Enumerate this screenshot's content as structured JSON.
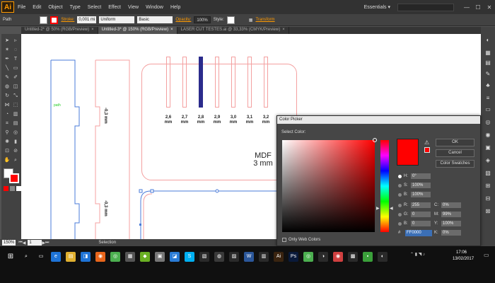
{
  "app": {
    "logo": "Ai",
    "workspace": "Essentials",
    "workspace_arrow": "▾"
  },
  "menu": [
    "File",
    "Edit",
    "Object",
    "Type",
    "Select",
    "Effect",
    "View",
    "Window",
    "Help"
  ],
  "window_controls": [
    "—",
    "☐",
    "✕"
  ],
  "control_bar": {
    "selection_type": "Path",
    "stroke_label": "Stroke:",
    "stroke_weight": "0,001 mi",
    "profile": "Uniform",
    "brush": "Basic",
    "opacity_label": "Opacity:",
    "opacity_value": "100%",
    "style_label": "Style:",
    "transform_label": "Transform",
    "colors": {
      "fill": "#ffffff",
      "stroke": "#ff0000"
    }
  },
  "tabs": [
    {
      "label": "Untitled-2* @ 50% (RGB/Preview)",
      "active": false
    },
    {
      "label": "Untitled-3* @ 150% (RGB/Preview)",
      "active": true
    },
    {
      "label": "LASER CUT TESTES.ai @ 33,33% (CMYK/Preview)",
      "active": false
    }
  ],
  "tab_close": "×",
  "canvas": {
    "measurements": [
      {
        "value": "2,6",
        "unit": "mm"
      },
      {
        "value": "2,7",
        "unit": "mm"
      },
      {
        "value": "2,8",
        "unit": "mm"
      },
      {
        "value": "2,9",
        "unit": "mm"
      },
      {
        "value": "3,0",
        "unit": "mm"
      },
      {
        "value": "3,1",
        "unit": "mm"
      },
      {
        "value": "3,2",
        "unit": "mm"
      }
    ],
    "material": "MDF",
    "thickness": "3 mm",
    "vertical_label_1": "-0,3 mm",
    "vertical_label_2": "-0,3 mm",
    "path_label": "path",
    "colors": {
      "selected_slot": "#2b2b8c",
      "cut_line": "#f4a0a0",
      "selection": "#4a7bd8"
    }
  },
  "status_bar": {
    "zoom": "150%",
    "page": "1",
    "tool": "Selection"
  },
  "color_picker": {
    "title": "Color Picker",
    "select_color_label": "Select Color:",
    "ok": "OK",
    "cancel": "Cancel",
    "swatches": "Color Swatches",
    "warning_icon": "⚠",
    "hsb": [
      {
        "label": "H:",
        "value": "0°",
        "selected": true
      },
      {
        "label": "S:",
        "value": "100%",
        "selected": false
      },
      {
        "label": "B:",
        "value": "100%",
        "selected": false
      }
    ],
    "rgb": [
      {
        "label": "R:",
        "value": "255"
      },
      {
        "label": "G:",
        "value": "0"
      },
      {
        "label": "B:",
        "value": "0"
      }
    ],
    "cmyk": [
      {
        "label": "C:",
        "value": "0%"
      },
      {
        "label": "M:",
        "value": "99%"
      },
      {
        "label": "Y:",
        "value": "100%"
      },
      {
        "label": "K:",
        "value": "0%"
      }
    ],
    "hex_label": "#",
    "hex": "FF0000",
    "only_web_colors": "Only Web Colors",
    "current_color": "#ff0000"
  },
  "taskbar": {
    "time": "17:06",
    "date": "13/02/2017",
    "apps": [
      {
        "name": "search-icon",
        "color": "#101010",
        "glyph": "⌕"
      },
      {
        "name": "task-view-icon",
        "color": "#101010",
        "glyph": "▭"
      },
      {
        "name": "edge-icon",
        "color": "#1e73d6",
        "glyph": "e"
      },
      {
        "name": "explorer-icon",
        "color": "#e0b030",
        "glyph": "▤"
      },
      {
        "name": "store-icon",
        "color": "#1e73d6",
        "glyph": "◨"
      },
      {
        "name": "firefox-icon",
        "color": "#e8661c",
        "glyph": "◉"
      },
      {
        "name": "chrome-icon",
        "color": "#4caf50",
        "glyph": "◎"
      },
      {
        "name": "calculator-icon",
        "color": "#555555",
        "glyph": "▦"
      },
      {
        "name": "greenapp-icon",
        "color": "#6ab023",
        "glyph": "◆"
      },
      {
        "name": "app-icon-1",
        "color": "#777777",
        "glyph": "▣"
      },
      {
        "name": "app-icon-2",
        "color": "#2a7bd5",
        "glyph": "◪"
      },
      {
        "name": "skype-icon",
        "color": "#00aff0",
        "glyph": "S"
      },
      {
        "name": "app-icon-3",
        "color": "#2a2a2a",
        "glyph": "▧"
      },
      {
        "name": "app-icon-4",
        "color": "#3a3a3a",
        "glyph": "◍"
      },
      {
        "name": "app-icon-5",
        "color": "#2a2a2a",
        "glyph": "▨"
      },
      {
        "name": "word-icon",
        "color": "#2b579a",
        "glyph": "W"
      },
      {
        "name": "app-icon-6",
        "color": "#2a2a2a",
        "glyph": "▥"
      },
      {
        "name": "illustrator-icon",
        "color": "#3a2410",
        "glyph": "Ai"
      },
      {
        "name": "photoshop-icon",
        "color": "#0a1a3a",
        "glyph": "Ps"
      },
      {
        "name": "chrome-icon-2",
        "color": "#4caf50",
        "glyph": "◎"
      },
      {
        "name": "app-icon-7",
        "color": "#2a2a2a",
        "glyph": "◑"
      },
      {
        "name": "app-icon-8",
        "color": "#d04040",
        "glyph": "◉"
      },
      {
        "name": "app-icon-9",
        "color": "#2a2a2a",
        "glyph": "▩"
      },
      {
        "name": "app-icon-10",
        "color": "#3aa03a",
        "glyph": "▪"
      },
      {
        "name": "app-icon-11",
        "color": "#2a2a2a",
        "glyph": "◐"
      }
    ]
  }
}
